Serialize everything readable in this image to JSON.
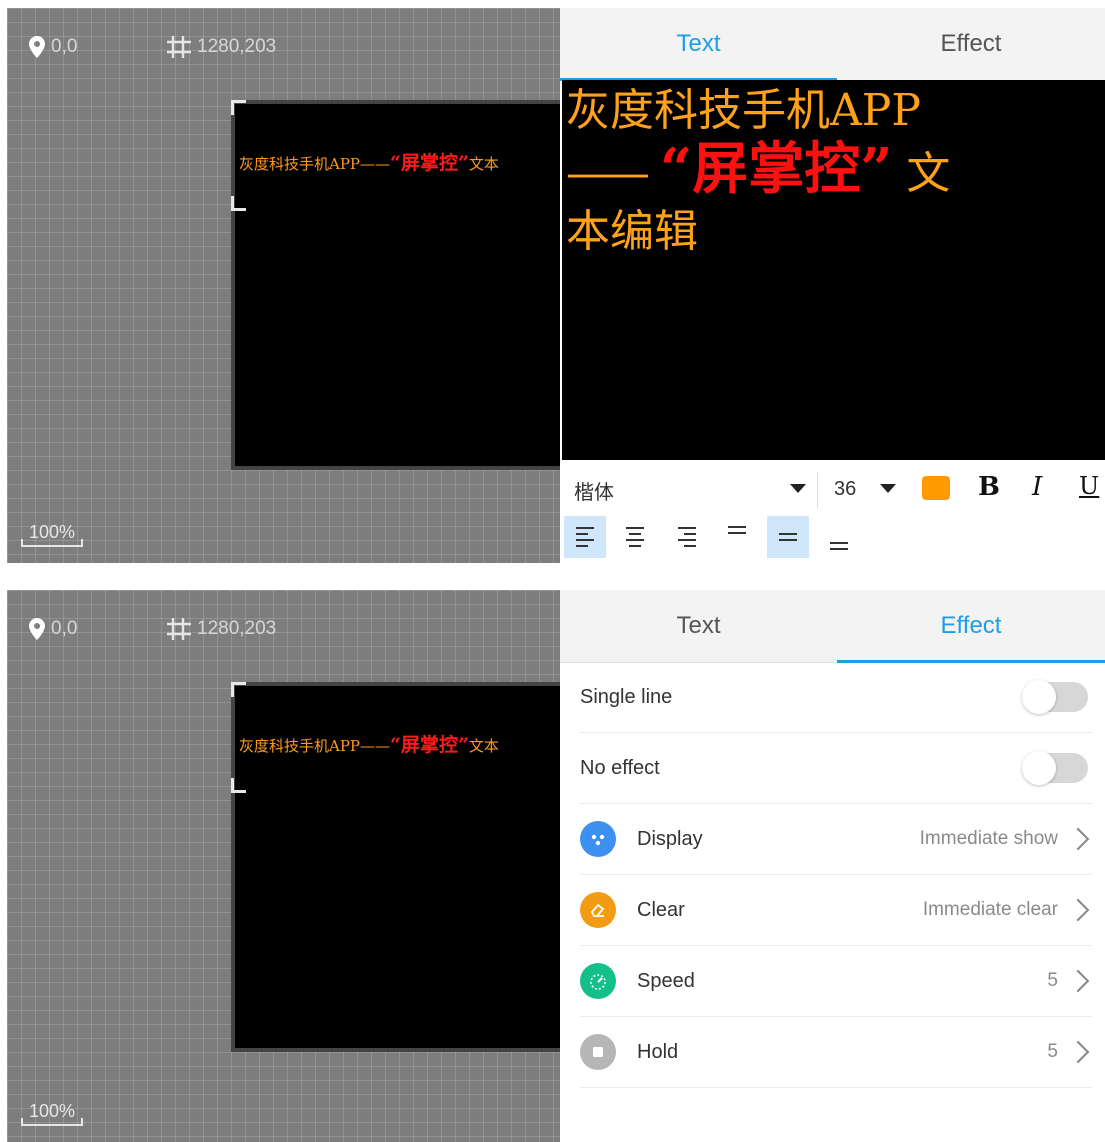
{
  "canvas": {
    "position": "0,0",
    "size": "1280,203",
    "zoom": "100%",
    "led_text_prefix": "灰度科技手机APP——",
    "led_text_highlight": "“屏掌控”",
    "led_text_suffix": "文本"
  },
  "tabs": {
    "text": "Text",
    "effect": "Effect"
  },
  "editor": {
    "line1": "灰度科技手机APP",
    "dash": "——",
    "highlight": "“屏掌控”",
    "tail1": "文",
    "line3": "本编辑"
  },
  "toolbar": {
    "font_name": "楷体",
    "font_size": "36",
    "color": "#ff9a00",
    "bold_label": "B",
    "italic_label": "I",
    "underline_label": "U"
  },
  "effects": {
    "single_line": "Single line",
    "no_effect": "No effect",
    "display_label": "Display",
    "display_value": "Immediate show",
    "clear_label": "Clear",
    "clear_value": "Immediate clear",
    "speed_label": "Speed",
    "speed_value": "5",
    "hold_label": "Hold",
    "hold_value": "5"
  },
  "colors": {
    "accent": "#1e9ee8",
    "display_icon": "#3d8ff0",
    "clear_icon": "#f39b12",
    "speed_icon": "#15bf8a",
    "hold_icon": "#b6b6b6"
  }
}
